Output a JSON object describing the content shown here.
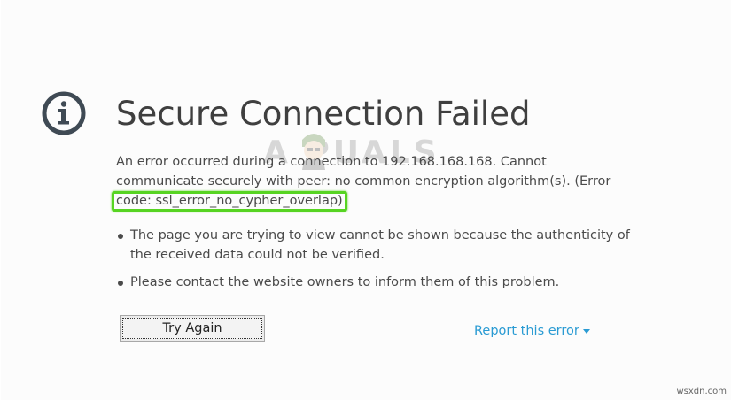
{
  "error_page": {
    "icon": "info-circle-icon",
    "title": "Secure Connection Failed",
    "message_part1": "An error occurred during a connection to 192.168.168.168. Cannot communicate securely with peer: no common encryption algorithm(s). (Error",
    "error_code": "code: ssl_error_no_cypher_overlap)",
    "bullets": [
      "The page you are trying to view cannot be shown because the authenticity of the received data could not be verified.",
      "Please contact the website owners to inform them of this problem."
    ],
    "try_again_label": "Try Again",
    "report_label": "Report this error"
  },
  "watermark": {
    "text": "A  PUALS"
  },
  "site_mark": "wsxdn.com",
  "colors": {
    "highlight": "#57d422",
    "link": "#2a9bd3",
    "text": "#4a4a4a",
    "background": "#fcfcfc"
  }
}
